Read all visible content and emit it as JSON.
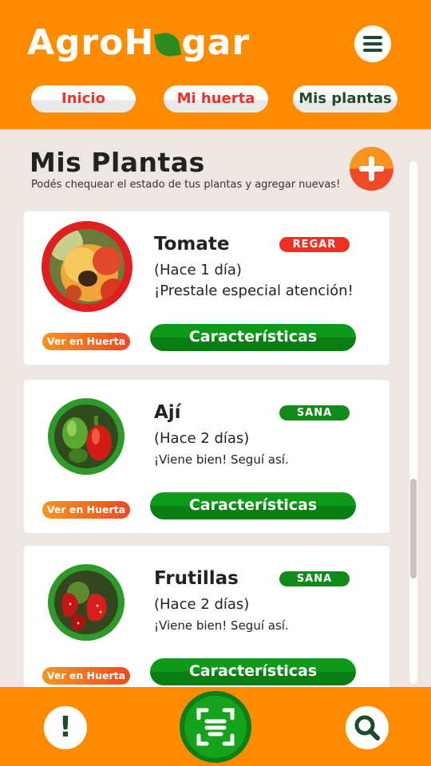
{
  "app": {
    "title_part1": "AgroH",
    "title_part2": "gar"
  },
  "nav": {
    "tabs": [
      {
        "label": "Inicio"
      },
      {
        "label": "Mi huerta"
      },
      {
        "label": "Mis plantas"
      }
    ]
  },
  "page": {
    "title": "Mis Plantas",
    "subtitle": "Podés chequear el estado de tus plantas y agregar nuevas!"
  },
  "plants": [
    {
      "name": "Tomate",
      "badge": "REGAR",
      "status_color": "#ee3124",
      "last_watered": "(Hace 1 día)",
      "note": "¡Prestale especial atención!",
      "huerta_button": "Ver en Huerta",
      "details_button": "Características"
    },
    {
      "name": "Ají",
      "badge": "SANA",
      "status_color": "#128a1a",
      "last_watered": "(Hace 2 días)",
      "note": "¡Viene bien! Seguí así.",
      "huerta_button": "Ver en Huerta",
      "details_button": "Características"
    },
    {
      "name": "Frutillas",
      "badge": "SANA",
      "status_color": "#128a1a",
      "last_watered": "(Hace 2 días)",
      "note": "¡Viene bien! Seguí así.",
      "huerta_button": "Ver en Huerta",
      "details_button": "Características"
    }
  ],
  "footer": {
    "alert_icon": "!",
    "icons": [
      "alert-icon",
      "scan-icon",
      "search-icon"
    ]
  },
  "colors": {
    "brand_orange": "#ff8c00",
    "alert_red": "#ee3124",
    "healthy_green": "#128a1a",
    "dark_green": "#1f4b2c"
  }
}
